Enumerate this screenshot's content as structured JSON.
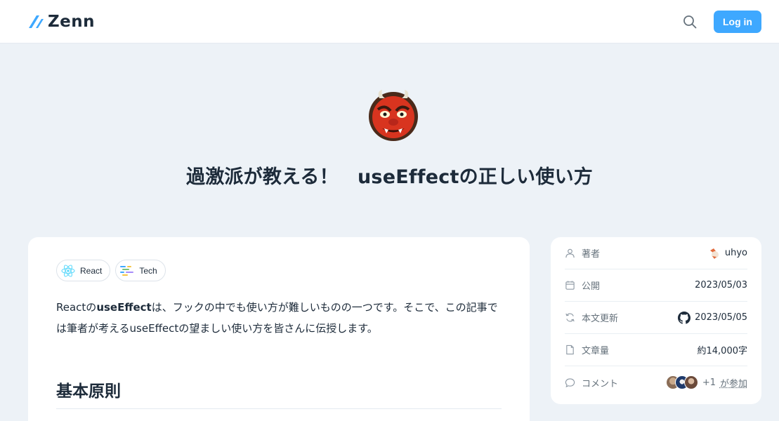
{
  "header": {
    "logo_text": "Zenn",
    "search_icon": "search-icon",
    "login_label": "Log in",
    "accent": "#3ea8ff"
  },
  "article": {
    "emoji": "ogre-emoji",
    "title": "過激派が教える！　useEffectの正しい使い方",
    "topics": [
      {
        "label": "React",
        "icon": "react-icon"
      },
      {
        "label": "Tech",
        "icon": "tech-icon"
      }
    ],
    "intro": {
      "part1": "Reactの",
      "bold": "useEffect",
      "part2": "は、フックの中でも使い方が難しいものの一つです。そこで、この記事では筆者が考えるuseEffectの望ましい使い方を皆さんに伝授します。"
    },
    "section_heading": "基本原則"
  },
  "sidebar": {
    "author": {
      "label": "著者",
      "value": "uhyo",
      "icon": "user-icon"
    },
    "published": {
      "label": "公開",
      "value": "2023/05/03",
      "icon": "calendar-icon"
    },
    "updated": {
      "label": "本文更新",
      "value": "2023/05/05",
      "icon": "refresh-icon",
      "value_icon": "github-icon"
    },
    "length": {
      "label": "文章量",
      "value": "約14,000字",
      "icon": "document-icon"
    },
    "comments": {
      "label": "コメント",
      "plus": "+1",
      "join": "が参加",
      "icon": "comment-icon"
    }
  }
}
